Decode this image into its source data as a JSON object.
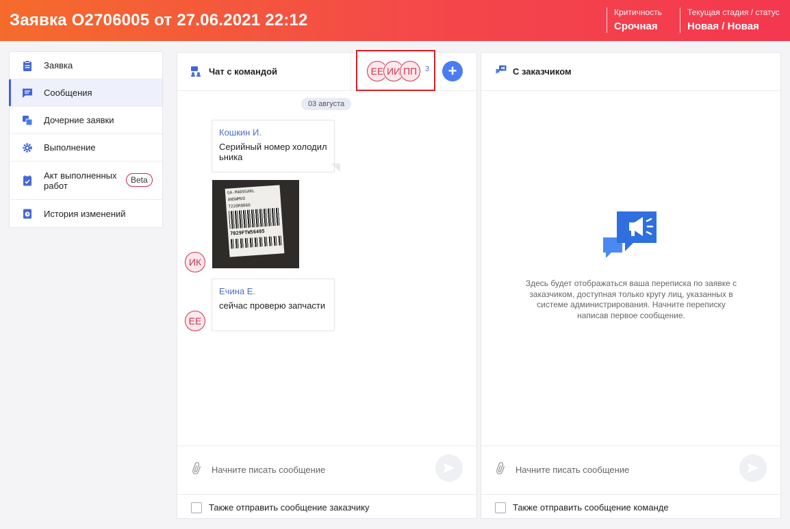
{
  "header": {
    "title": "Заявка O2706005 от 27.06.2021 22:12",
    "criticality_label": "Критичность",
    "criticality_value": "Срочная",
    "stage_label": "Текущая стадия / статус",
    "stage_value": "Новая / Новая"
  },
  "sidebar": {
    "items": [
      {
        "label": "Заявка",
        "icon": "clipboard-icon"
      },
      {
        "label": "Сообщения",
        "icon": "chat-icon",
        "active": true
      },
      {
        "label": "Дочерние заявки",
        "icon": "child-requests-icon"
      },
      {
        "label": "Выполнение",
        "icon": "gear-icon"
      },
      {
        "label": "Акт выполненных работ",
        "icon": "act-icon",
        "badge": "Beta"
      },
      {
        "label": "История изменений",
        "icon": "history-icon"
      }
    ]
  },
  "team_chat": {
    "title": "Чат с командой",
    "participants": [
      "ЕЕ",
      "ИИ",
      "ПП"
    ],
    "participants_count": "3",
    "date_chip": "03 августа",
    "messages": [
      {
        "author": "Кошкин И.",
        "text": "Серийный номер холодильника",
        "avatar": "ИК"
      },
      {
        "author": "Ечина Е.",
        "text": "сейчас проверю запчасти",
        "avatar": "ЕЕ"
      }
    ],
    "photo_label": {
      "model": "GA-M409SARL",
      "brand": "ANSWMVO",
      "code": "7220R0066",
      "serial": "7029FTW56405"
    },
    "input_placeholder": "Начните писать сообщение",
    "checkbox_label": "Также отправить сообщение заказчику"
  },
  "customer_chat": {
    "title": "С заказчиком",
    "empty_text": "Здесь будет отображаться ваша переписка по заявке с заказчиком, доступная только кругу лиц, указанных в системе администрирования. Начните переписку написав первое сообщение.",
    "input_placeholder": "Начните писать сообщение",
    "checkbox_label": "Также отправить сообщение команде"
  },
  "colors": {
    "header_gradient_start": "#f56b2c",
    "header_gradient_end": "#f4384f",
    "accent_blue": "#4a7ef0",
    "avatar_red": "#c9334f",
    "highlight_box": "#d41f26"
  }
}
